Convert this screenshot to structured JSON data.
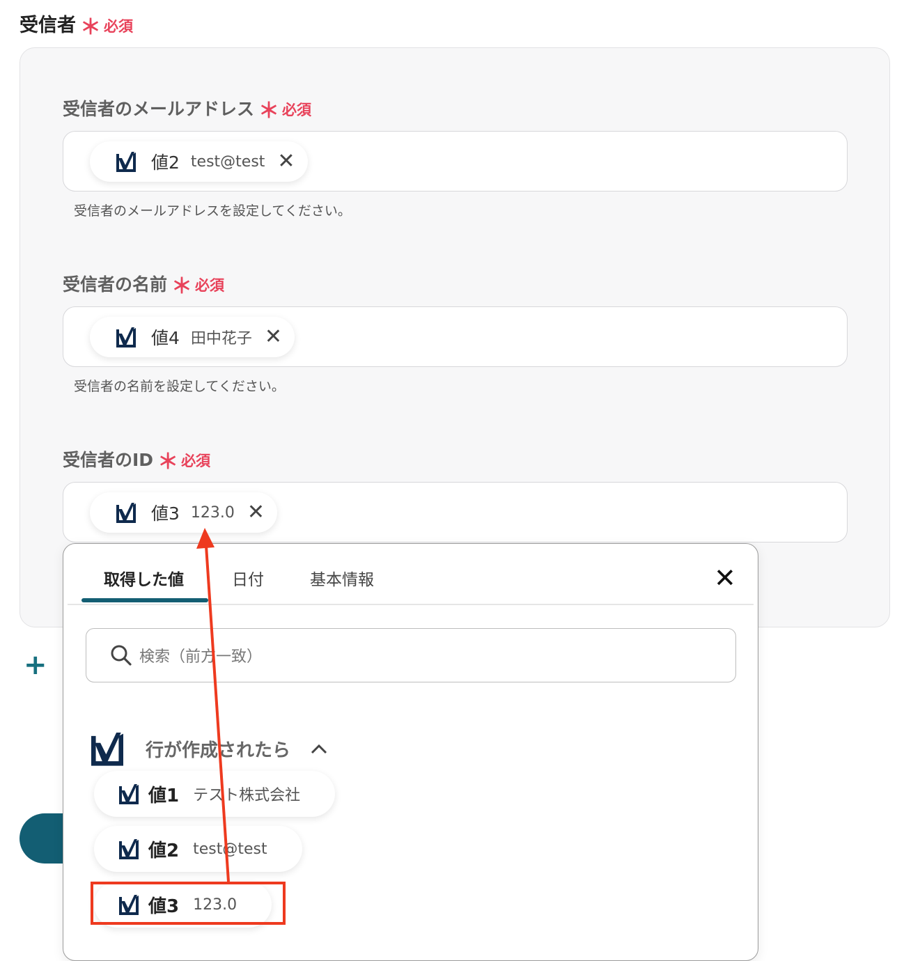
{
  "section": {
    "title": "受信者",
    "required_star": "＊",
    "required_text": "必須"
  },
  "fields": [
    {
      "label": "受信者のメールアドレス",
      "chip_name": "値2",
      "chip_value": "test@test",
      "hint": "受信者のメールアドレスを設定してください。"
    },
    {
      "label": "受信者の名前",
      "chip_name": "値4",
      "chip_value": "田中花子",
      "hint": "受信者の名前を設定してください。"
    },
    {
      "label": "受信者のID",
      "chip_name": "値3",
      "chip_value": "123.0"
    }
  ],
  "add_button": {
    "label": "+"
  },
  "dropdown": {
    "tabs": [
      "取得した値",
      "日付",
      "基本情報"
    ],
    "active_tab": "取得した値",
    "close_glyph": "✕",
    "search_placeholder": "検索（前方一致）",
    "group": {
      "title": "行が作成されたら",
      "chevron": "^"
    },
    "items": [
      {
        "name": "値1",
        "value": "テスト株式会社"
      },
      {
        "name": "値2",
        "value": "test@test"
      },
      {
        "name": "値3",
        "value": "123.0"
      }
    ]
  },
  "colors": {
    "accent": "#135e73",
    "required": "#e8425a",
    "annotation": "#ee3a1f",
    "icon_navy": "#0f2a4d"
  },
  "icons": {
    "app": "smartsheet-check-icon",
    "remove": "close-icon",
    "search": "search-icon",
    "collapse": "chevron-up-icon"
  }
}
